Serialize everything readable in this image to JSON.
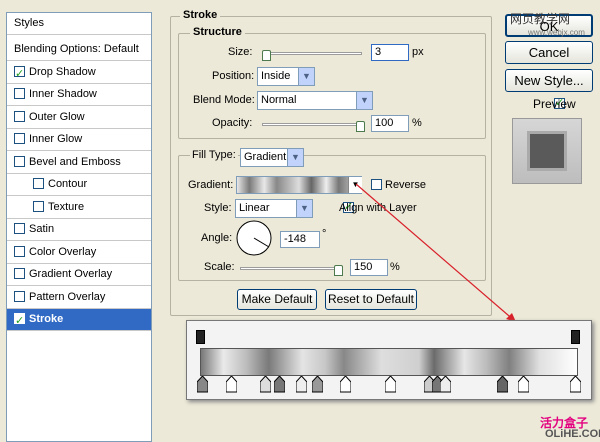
{
  "styles_panel": {
    "header": "Styles",
    "blending": "Blending Options: Default",
    "items": [
      {
        "label": "Drop Shadow",
        "checked": true
      },
      {
        "label": "Inner Shadow",
        "checked": false
      },
      {
        "label": "Outer Glow",
        "checked": false
      },
      {
        "label": "Inner Glow",
        "checked": false
      },
      {
        "label": "Bevel and Emboss",
        "checked": false
      },
      {
        "label": "Contour",
        "checked": false
      },
      {
        "label": "Texture",
        "checked": false
      },
      {
        "label": "Satin",
        "checked": false
      },
      {
        "label": "Color Overlay",
        "checked": false
      },
      {
        "label": "Gradient Overlay",
        "checked": false
      },
      {
        "label": "Pattern Overlay",
        "checked": false
      },
      {
        "label": "Stroke",
        "checked": true
      }
    ]
  },
  "stroke": {
    "title": "Stroke",
    "structure_title": "Structure",
    "size_label": "Size:",
    "size_value": "3",
    "size_unit": "px",
    "position_label": "Position:",
    "position_value": "Inside",
    "blend_label": "Blend Mode:",
    "blend_value": "Normal",
    "opacity_label": "Opacity:",
    "opacity_value": "100",
    "opacity_unit": "%",
    "fill_type_label": "Fill Type:",
    "fill_type_value": "Gradient",
    "gradient_label": "Gradient:",
    "reverse_label": "Reverse",
    "style_label": "Style:",
    "style_value": "Linear",
    "align_label": "Align with Layer",
    "angle_label": "Angle:",
    "angle_value": "-148",
    "angle_unit": "°",
    "scale_label": "Scale:",
    "scale_value": "150",
    "scale_unit": "%",
    "make_default": "Make Default",
    "reset_default": "Reset to Default"
  },
  "side_buttons": {
    "ok": "OK",
    "cancel": "Cancel",
    "new_style": "New Style...",
    "preview": "Preview"
  },
  "watermarks": {
    "top": "网页教学网",
    "site": "www.webjx.com",
    "bottom": "活力盒子",
    "olihe": "OLiHE.COM"
  }
}
